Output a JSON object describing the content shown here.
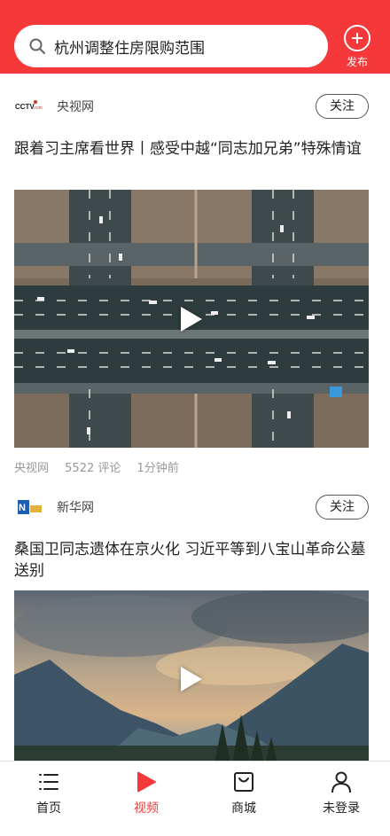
{
  "search": {
    "query": "杭州调整住房限购范围"
  },
  "header": {
    "publish_label": "发布"
  },
  "cards": [
    {
      "source": "央视网",
      "logo_text": "CCTV",
      "follow_label": "关注",
      "title": "跟着习主席看世界丨感受中越“同志加兄弟”特殊情谊",
      "meta": {
        "source": "央视网",
        "comments": "5522 评论",
        "time": "1分钟前"
      }
    },
    {
      "source": "新华网",
      "logo_text": "新华网",
      "follow_label": "关注",
      "title": "桑国卫同志遗体在京火化 习近平等到八宝山革命公墓送别"
    }
  ],
  "bottom_nav": {
    "items": [
      {
        "label": "首页",
        "icon": "list-icon"
      },
      {
        "label": "视频",
        "icon": "play-icon",
        "active": true
      },
      {
        "label": "商城",
        "icon": "shopping-bag-icon"
      },
      {
        "label": "未登录",
        "icon": "user-icon"
      }
    ]
  },
  "colors": {
    "brand_red": "#f5383a",
    "meta_gray": "#999999"
  }
}
